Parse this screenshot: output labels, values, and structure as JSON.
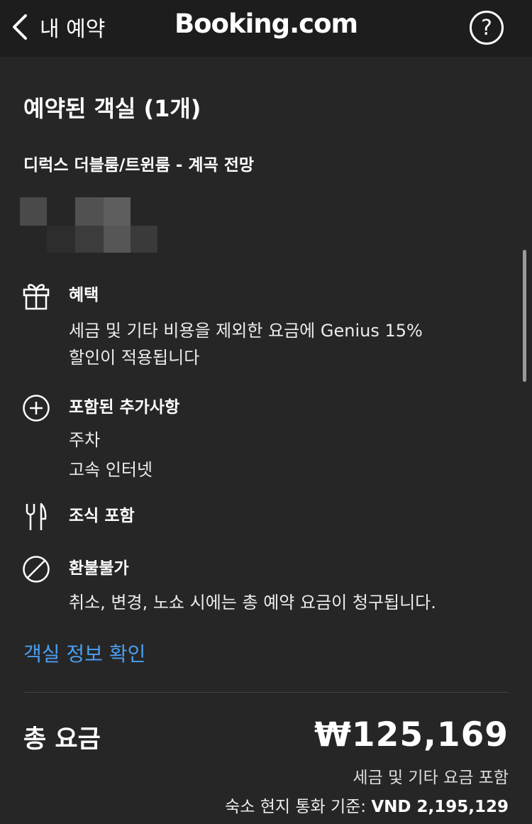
{
  "header": {
    "back_label": "내 예약",
    "brand": "Booking.com",
    "help_symbol": "?"
  },
  "rooms": {
    "section_title": "예약된 객실 (1개)",
    "room_name": "디럭스 더블룸/트윈룸 - 계곡 전망"
  },
  "features": {
    "benefit": {
      "title": "혜택",
      "lines": [
        "세금 및 기타 비용을 제외한 요금에 Genius 15%",
        "할인이 적용됩니다"
      ]
    },
    "extras": {
      "title": "포함된 추가사항",
      "lines": [
        "주차",
        "고속 인터넷"
      ]
    },
    "breakfast": {
      "title": "조식 포함"
    },
    "refund": {
      "title": "환불불가",
      "lines": [
        "취소, 변경, 노쇼 시에는 총 예약 요금이 청구됩니다."
      ]
    }
  },
  "room_info_link": "객실 정보 확인",
  "total": {
    "label": "총 요금",
    "value": "₩125,169",
    "note": "세금 및 기타 요금 포함",
    "local_prefix": "숙소 현지 통화 기준: ",
    "local_value": "VND 2,195,129"
  },
  "colors": {
    "background": "#262626",
    "topbar": "#1d1d1d",
    "link": "#4a9ff0"
  }
}
